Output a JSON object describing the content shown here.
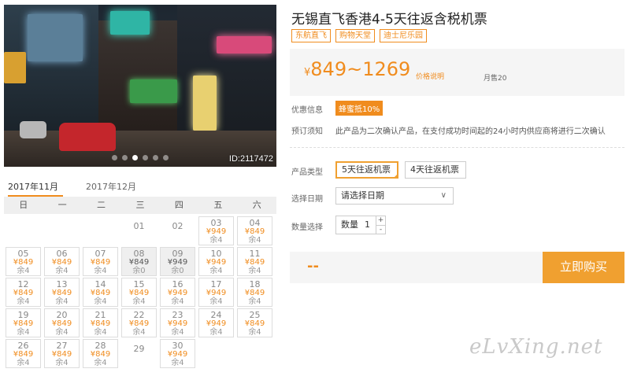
{
  "product": {
    "title": "无锡直飞香港4-5天往返含税机票",
    "tags": [
      "东航直飞",
      "购物天堂",
      "迪士尼乐园"
    ],
    "price_range": "849~1269",
    "currency": "¥",
    "price_note": "价格说明",
    "monthly_sales": "月售20"
  },
  "photo": {
    "watermark": "ID:2117472",
    "slide_count": 6,
    "active_slide": 3
  },
  "calendar": {
    "month_tabs": [
      {
        "label": "2017年11月",
        "active": true
      },
      {
        "label": "2017年12月",
        "active": false
      }
    ],
    "weekdays": [
      "日",
      "一",
      "二",
      "三",
      "四",
      "五",
      "六"
    ],
    "leading_blanks": 3,
    "days": [
      {
        "day": "01"
      },
      {
        "day": "02"
      },
      {
        "day": "03",
        "price": "¥949",
        "remain": "余4"
      },
      {
        "day": "04",
        "price": "¥849",
        "remain": "余4"
      },
      {
        "day": "05",
        "price": "¥849",
        "remain": "余4"
      },
      {
        "day": "06",
        "price": "¥849",
        "remain": "余4"
      },
      {
        "day": "07",
        "price": "¥849",
        "remain": "余4"
      },
      {
        "day": "08",
        "price": "¥849",
        "remain": "余0",
        "soldout": true
      },
      {
        "day": "09",
        "price": "¥949",
        "remain": "余0",
        "soldout": true
      },
      {
        "day": "10",
        "price": "¥949",
        "remain": "余4"
      },
      {
        "day": "11",
        "price": "¥849",
        "remain": "余4"
      },
      {
        "day": "12",
        "price": "¥849",
        "remain": "余4"
      },
      {
        "day": "13",
        "price": "¥849",
        "remain": "余4"
      },
      {
        "day": "14",
        "price": "¥849",
        "remain": "余4"
      },
      {
        "day": "15",
        "price": "¥849",
        "remain": "余4"
      },
      {
        "day": "16",
        "price": "¥949",
        "remain": "余4"
      },
      {
        "day": "17",
        "price": "¥949",
        "remain": "余4"
      },
      {
        "day": "18",
        "price": "¥849",
        "remain": "余4"
      },
      {
        "day": "19",
        "price": "¥849",
        "remain": "余4"
      },
      {
        "day": "20",
        "price": "¥849",
        "remain": "余4"
      },
      {
        "day": "21",
        "price": "¥849",
        "remain": "余4"
      },
      {
        "day": "22",
        "price": "¥849",
        "remain": "余4"
      },
      {
        "day": "23",
        "price": "¥949",
        "remain": "余4"
      },
      {
        "day": "24",
        "price": "¥949",
        "remain": "余4"
      },
      {
        "day": "25",
        "price": "¥849",
        "remain": "余4"
      },
      {
        "day": "26",
        "price": "¥849",
        "remain": "余4"
      },
      {
        "day": "27",
        "price": "¥849",
        "remain": "余4"
      },
      {
        "day": "28",
        "price": "¥849",
        "remain": "余4"
      },
      {
        "day": "29"
      },
      {
        "day": "30",
        "price": "¥949",
        "remain": "余4"
      }
    ]
  },
  "promo": {
    "label": "优惠信息",
    "badge": "蜂蜜抵10%"
  },
  "notice": {
    "label": "预订须知",
    "text": "此产品为二次确认产品，在支付成功时间起的24小时内供应商将进行二次确认"
  },
  "product_type": {
    "label": "产品类型",
    "options": [
      {
        "label": "5天往返机票",
        "selected": true
      },
      {
        "label": "4天往返机票",
        "selected": false
      }
    ]
  },
  "date_select": {
    "label": "选择日期",
    "placeholder": "请选择日期"
  },
  "quantity": {
    "label": "数量选择",
    "prefix": "数量",
    "value": "1",
    "plus": "+",
    "minus": "-"
  },
  "order": {
    "total": "--",
    "buy_label": "立即购买"
  },
  "site_logo": "eLvXing.net",
  "colors": {
    "accent": "#f08c1e",
    "button": "#f0a030"
  }
}
